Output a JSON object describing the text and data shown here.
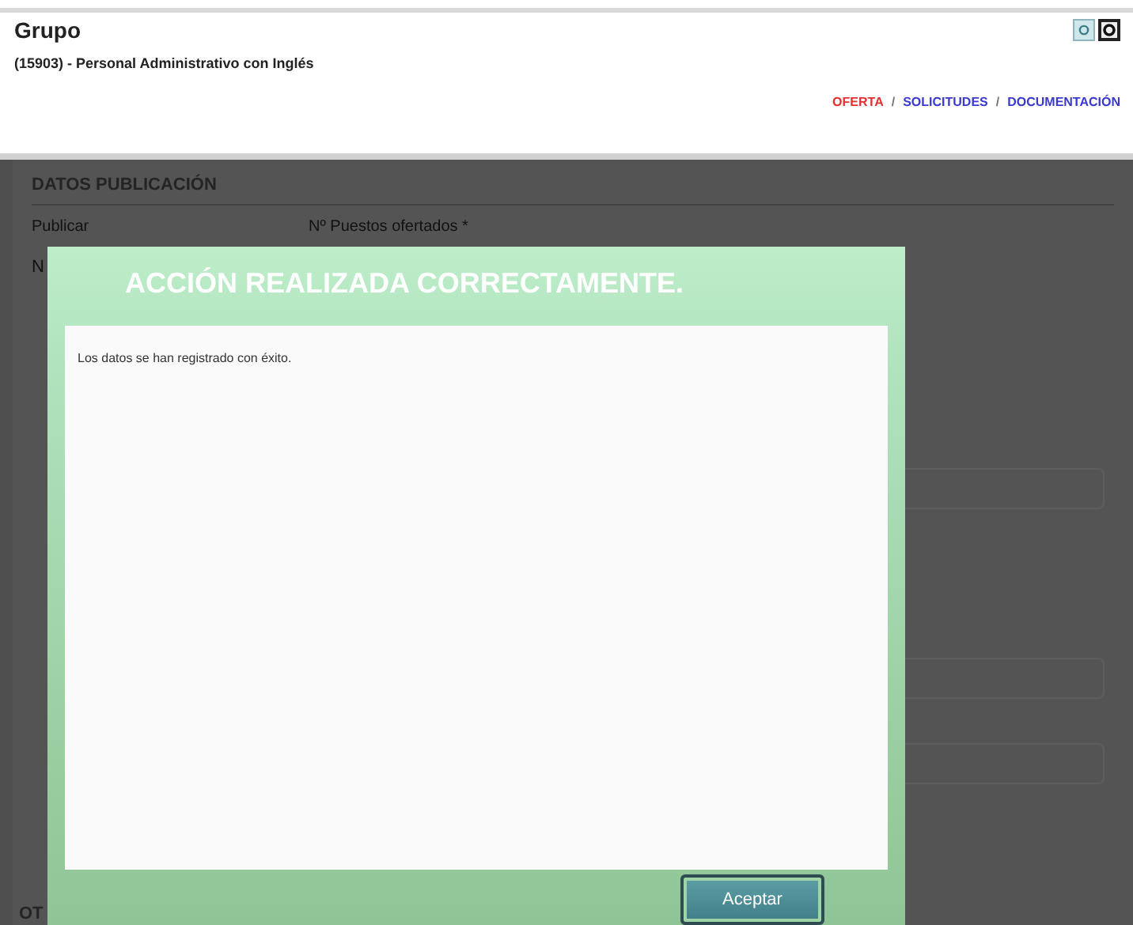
{
  "header": {
    "title": "Grupo",
    "subtitle": "(15903) - Personal Administrativo con Inglés",
    "nav": [
      {
        "label": "OFERTA",
        "selected": true
      },
      {
        "label": "SOLICITUDES",
        "selected": false
      },
      {
        "label": "DOCUMENTACIÓN",
        "selected": false
      }
    ],
    "separator": "/"
  },
  "form": {
    "section": "DATOS PUBLICACIÓN",
    "labels": [
      "Publicar",
      "Nº Puestos ofertados *"
    ],
    "value": "N",
    "next_section": "OT"
  },
  "dialog": {
    "title": "ACCIÓN REALIZADA CORRECTAMENTE.",
    "message": "Los datos se han registrado con éxito.",
    "button": "Aceptar"
  }
}
